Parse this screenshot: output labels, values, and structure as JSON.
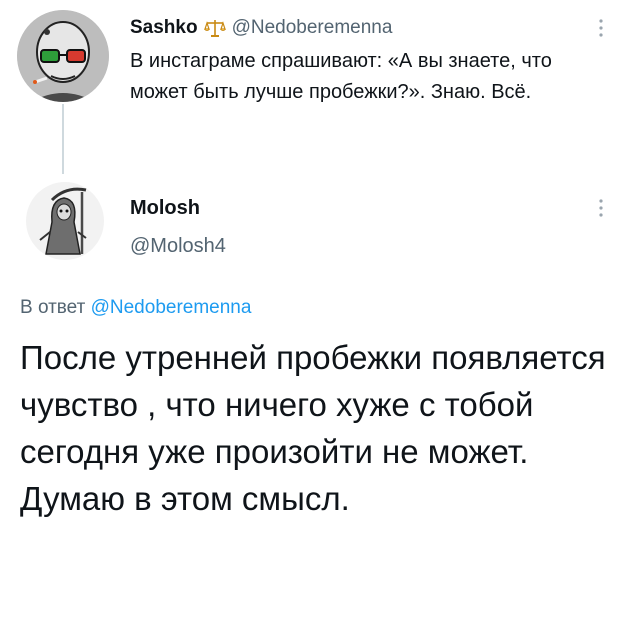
{
  "tweet1": {
    "author_name": "Sashko",
    "name_emoji": "scales-icon",
    "handle": "@Nedoberemenna",
    "text": "В инстаграме спрашивают: «А вы знаете, что может быть лучше пробежки?». Знаю. Всё."
  },
  "tweet2": {
    "author_name": "Molosh",
    "handle": "@Molosh4",
    "reply_prefix": "В ответ ",
    "reply_mention": "@Nedoberemenna",
    "text": "После утренней пробежки появляется чувство , что ничего хуже с тобой сегодня уже произойти не может. Думаю в этом смысл."
  },
  "colors": {
    "text_primary": "#0f1419",
    "text_secondary": "#536471",
    "link": "#1d9bf0",
    "thread_line": "#cfd9de",
    "background": "#ffffff"
  }
}
